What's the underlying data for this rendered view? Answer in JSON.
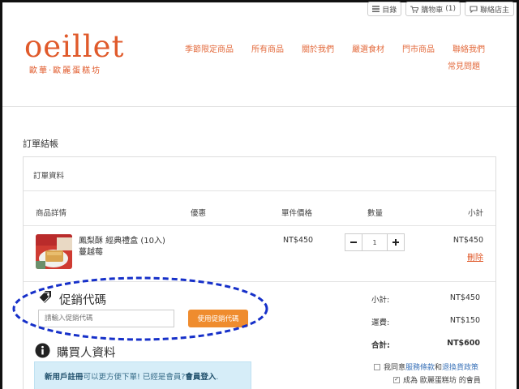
{
  "topbar": {
    "catalog_label": "目錄",
    "cart_label": "購物車",
    "cart_count": "(1)",
    "contact_label": "聯絡店主"
  },
  "brand": {
    "logo_main": "oeillet",
    "logo_sub": "歐華·歐麗蛋糕坊",
    "accent_color": "#e05a2b"
  },
  "nav": {
    "items": [
      "季節限定商品",
      "所有商品",
      "關於我們",
      "嚴選食材",
      "門市商品",
      "聯絡我們"
    ],
    "faq": "常見問題"
  },
  "page": {
    "title": "訂單結帳"
  },
  "order": {
    "heading": "訂單資料",
    "columns": {
      "details": "商品詳情",
      "discount": "優惠",
      "unit_price": "單件價格",
      "quantity": "數量",
      "subtotal": "小計"
    },
    "item": {
      "name_line1": "鳳梨酥 經典禮盒 (10入)",
      "name_line2": "蔓越莓",
      "unit_price": "NT$450",
      "quantity": "1",
      "subtotal": "NT$450",
      "delete_label": "刪除"
    }
  },
  "promo": {
    "title": "促銷代碼",
    "placeholder": "請輸入促銷代碼",
    "button": "使用促銷代碼"
  },
  "buyer": {
    "title": "購買人資料",
    "register_link": "新用戶註冊",
    "register_text": "可以更方便下單! 已經是會員?",
    "login_link": "會員登入",
    "login_suffix": "."
  },
  "summary": {
    "subtotal_label": "小計:",
    "subtotal_value": "NT$450",
    "shipping_label": "運費:",
    "shipping_value": "NT$150",
    "total_label": "合計:",
    "total_value": "NT$600"
  },
  "agreement": {
    "prefix": "我同意",
    "terms_link": "服務條款",
    "and": "和",
    "return_link": "退換貨政策",
    "member_text": "成為 歐麗蛋糕坊 的會員"
  }
}
